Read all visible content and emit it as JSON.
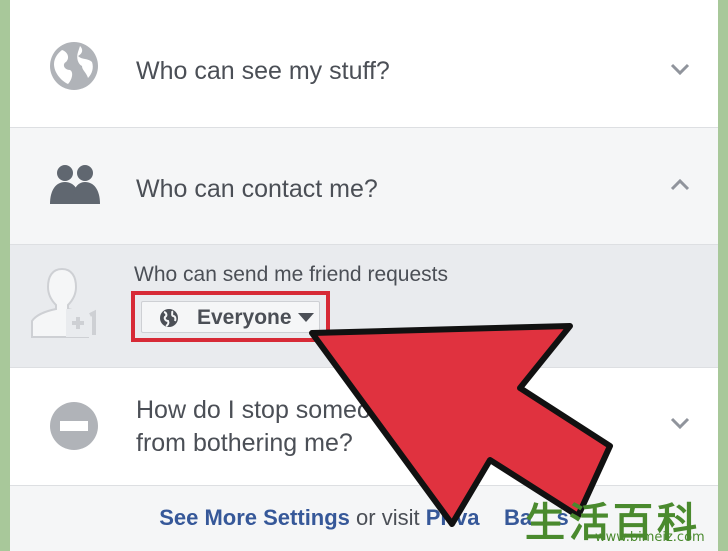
{
  "settings": {
    "rows": [
      {
        "question": "Who can see my stuff?",
        "icon": "globe-icon",
        "state": "collapsed"
      },
      {
        "question": "Who can contact me?",
        "icon": "friends-icon",
        "state": "expanded"
      },
      {
        "question_line1": "How do I stop someo",
        "question_line2": "from bothering me?",
        "icon": "block-icon",
        "state": "collapsed"
      }
    ],
    "friend_requests": {
      "label": "Who can send me friend requests",
      "value": "Everyone",
      "icon": "add-friend-icon"
    }
  },
  "footer": {
    "see_more": "See More Settings",
    "or_visit": " or visit ",
    "privacy_basics": "Priva    Ba    s"
  },
  "watermark": {
    "chars": "生活百科",
    "url": "www.bimeiz.com"
  },
  "colors": {
    "link": "#365899",
    "highlight": "#d72a36",
    "arrow": "#e0323f",
    "background": "#a8c89a"
  }
}
